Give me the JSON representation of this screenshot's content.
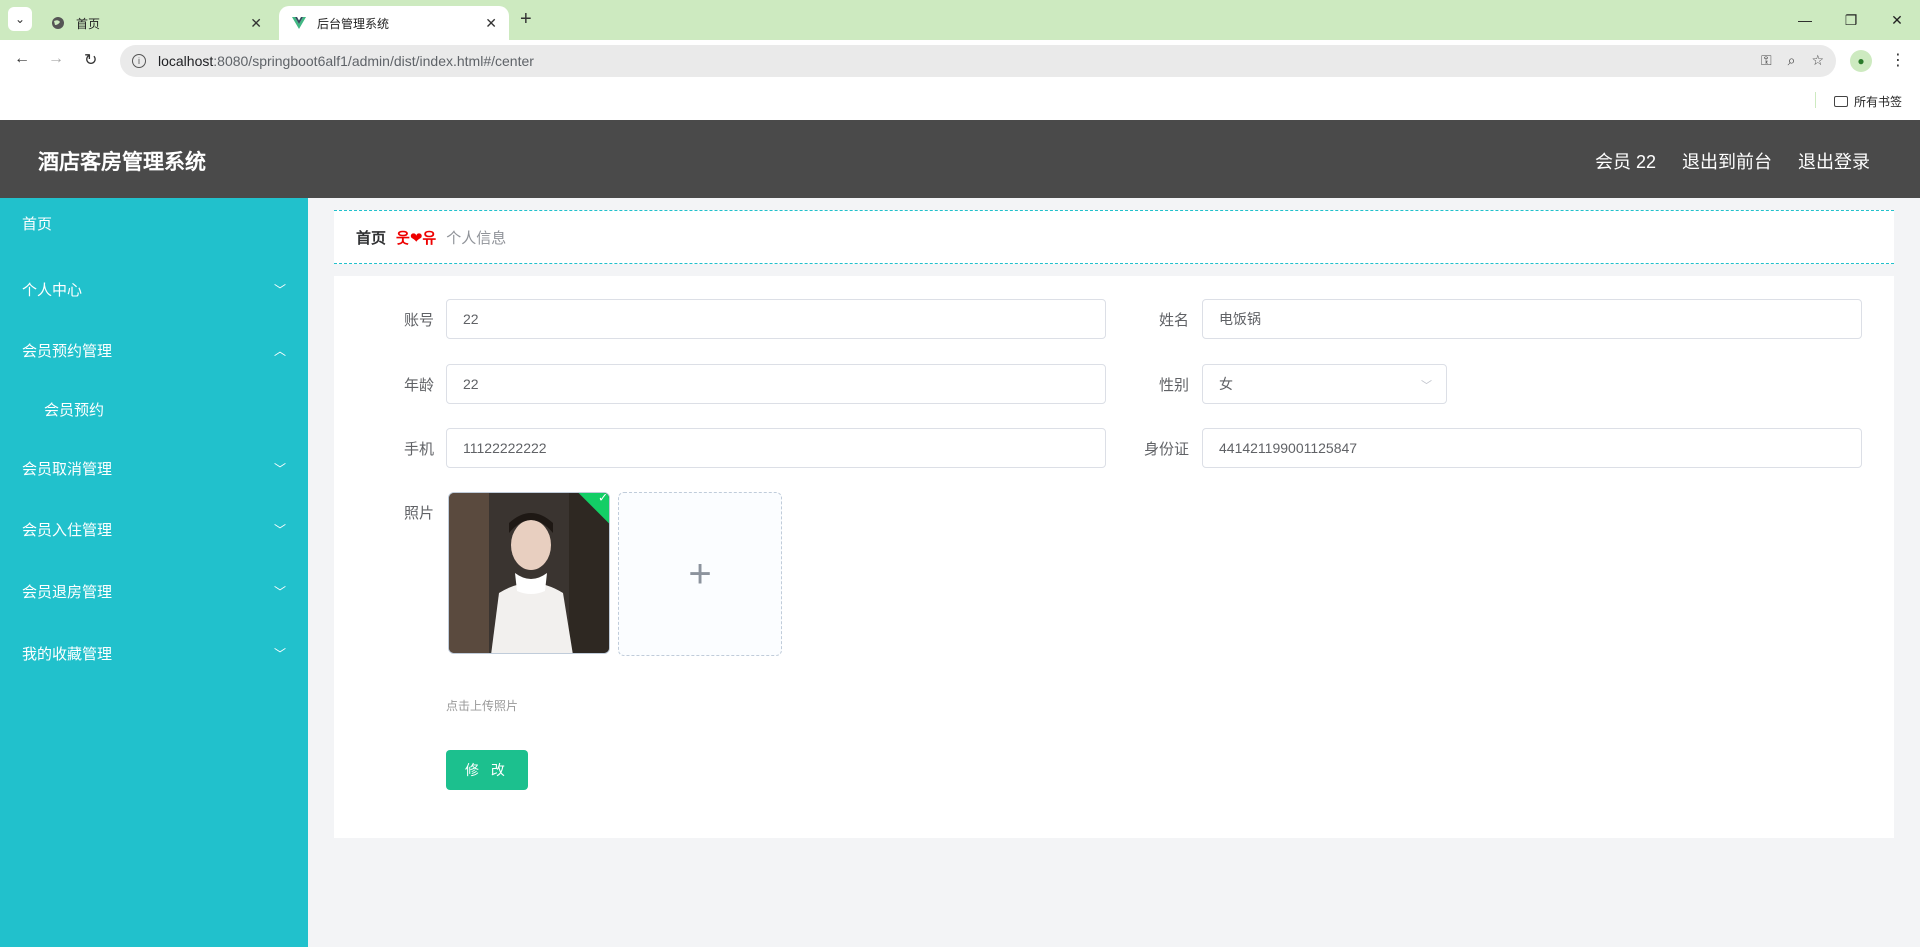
{
  "browser": {
    "tabs": [
      {
        "title": "首页",
        "active": false
      },
      {
        "title": "后台管理系统",
        "active": true
      }
    ],
    "url_host": "localhost",
    "url_path": ":8080/springboot6alf1/admin/dist/index.html#/center",
    "bookmarks_label": "所有书签"
  },
  "header": {
    "title": "酒店客房管理系统",
    "user_label": "会员 22",
    "back_to_front": "退出到前台",
    "logout": "退出登录"
  },
  "sidebar": {
    "items": [
      {
        "label": "首页",
        "expandable": false
      },
      {
        "label": "个人中心",
        "expandable": true,
        "expanded": false
      },
      {
        "label": "会员预约管理",
        "expandable": true,
        "expanded": true
      },
      {
        "label": "会员预约",
        "sub": true
      },
      {
        "label": "会员取消管理",
        "expandable": true,
        "expanded": false
      },
      {
        "label": "会员入住管理",
        "expandable": true,
        "expanded": false
      },
      {
        "label": "会员退房管理",
        "expandable": true,
        "expanded": false
      },
      {
        "label": "我的收藏管理",
        "expandable": true,
        "expanded": false
      }
    ]
  },
  "breadcrumb": {
    "home": "首页",
    "separator": "웃❤유",
    "current": "个人信息"
  },
  "form": {
    "account_label": "账号",
    "account_value": "22",
    "name_label": "姓名",
    "name_value": "电饭锅",
    "age_label": "年龄",
    "age_value": "22",
    "gender_label": "性别",
    "gender_value": "女",
    "phone_label": "手机",
    "phone_value": "11122222222",
    "idcard_label": "身份证",
    "idcard_value": "441421199001125847",
    "photo_label": "照片",
    "upload_hint": "点击上传照片",
    "submit_label": "修 改"
  },
  "colors": {
    "sidebar": "#21c1cc",
    "header": "#4a4a4a",
    "button": "#1cc08e",
    "tabbar": "#cdeac0"
  }
}
